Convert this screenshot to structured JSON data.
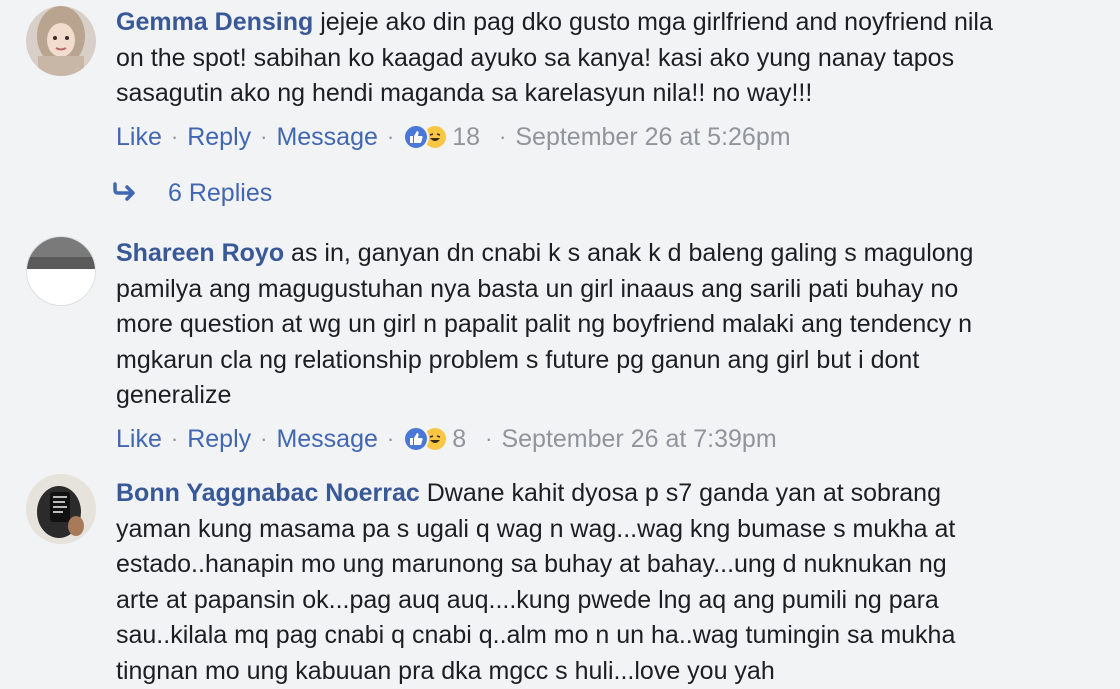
{
  "comments": [
    {
      "author": "Gemma Densing",
      "text": " jejeje ako din pag dko gusto mga girlfriend and noyfriend nila\non the spot! sabihan ko kaagad ayuko sa kanya! kasi ako yung nanay tapos\nsasagutin ako ng hendi maganda sa karelasyun nila!! no way!!!",
      "actions": {
        "like": "Like",
        "reply": "Reply",
        "message": "Message"
      },
      "reaction_count": "18",
      "timestamp": "September 26 at 5:26pm",
      "replies_label": "6 Replies"
    },
    {
      "author": "Shareen Royo",
      "text": " as in, ganyan dn cnabi k s anak k d baleng galing s magulong\npamilya ang magugustuhan nya basta un girl inaaus ang sarili pati buhay no\nmore question at wg un girl n papalit palit ng boyfriend malaki ang tendency n\nmgkarun cla ng relationship problem s future pg ganun ang girl but i dont\ngeneralize",
      "actions": {
        "like": "Like",
        "reply": "Reply",
        "message": "Message"
      },
      "reaction_count": "8",
      "timestamp": "September 26 at 7:39pm"
    },
    {
      "author": "Bonn Yaggnabac Noerrac",
      "text": " Dwane kahit dyosa p s7 ganda yan at sobrang\nyaman kung masama pa s ugali q wag n wag...wag kng bumase s mukha at\nestado..hanapin mo ung marunong sa buhay at bahay...ung d nuknukan ng\narte at papansin ok...pag auq auq....kung pwede lng aq ang pumili ng para\nsau..kilala mq pag cnabi q cnabi q..alm mo n un ha..wag tumingin sa mukha\ntingnan mo ung kabuuan pra dka mgcc s huli...love you yah"
    }
  ],
  "colors": {
    "background": "#f2f3f5",
    "author": "#385898",
    "link": "#4267b2",
    "meta": "#90949c",
    "text": "#1c1e21"
  },
  "icons": {
    "like_reaction": "thumbs-up-icon",
    "haha_reaction": "laughing-face-icon",
    "reply_arrow": "reply-arrow-icon"
  }
}
